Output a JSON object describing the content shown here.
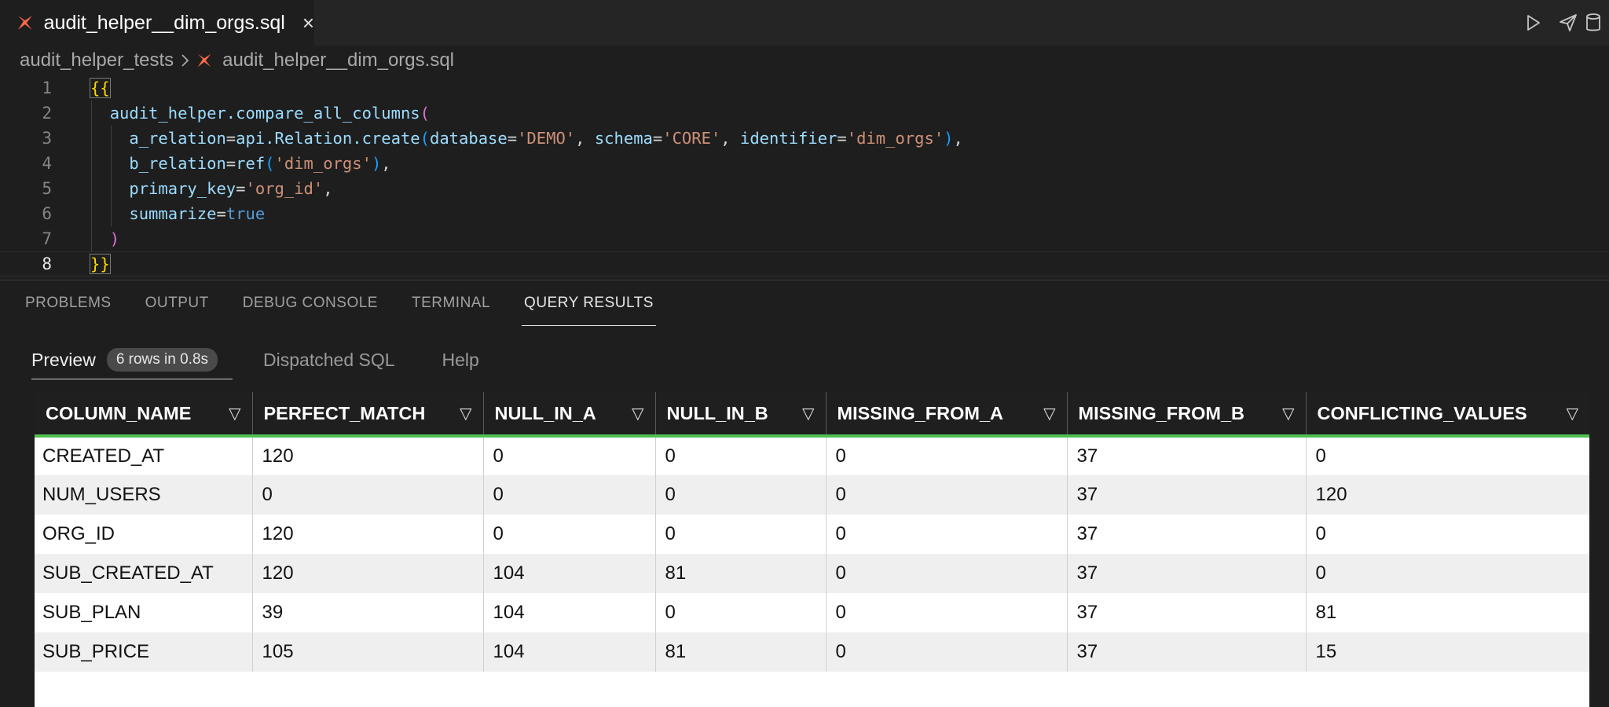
{
  "tab": {
    "title": "audit_helper__dim_orgs.sql",
    "close": "×"
  },
  "actions": [
    "run-icon",
    "send-icon",
    "database-icon"
  ],
  "breadcrumb": {
    "folder": "audit_helper_tests",
    "file": "audit_helper__dim_orgs.sql"
  },
  "editor": {
    "line_numbers": [
      "1",
      "2",
      "3",
      "4",
      "5",
      "6",
      "7",
      "8"
    ],
    "lines": [
      [
        {
          "t": "{{",
          "c": "t-brace-box"
        }
      ],
      [
        {
          "t": "  ",
          "c": "t-plain"
        },
        {
          "t": "audit_helper.compare_all_columns",
          "c": "t-default"
        },
        {
          "t": "(",
          "c": "t-paren1"
        }
      ],
      [
        {
          "t": "    ",
          "c": "t-plain"
        },
        {
          "t": "a_relation",
          "c": "t-param"
        },
        {
          "t": "=",
          "c": "t-plain"
        },
        {
          "t": "api.Relation.create",
          "c": "t-default"
        },
        {
          "t": "(",
          "c": "t-paren2"
        },
        {
          "t": "database",
          "c": "t-param"
        },
        {
          "t": "=",
          "c": "t-plain"
        },
        {
          "t": "'DEMO'",
          "c": "t-string"
        },
        {
          "t": ", ",
          "c": "t-plain"
        },
        {
          "t": "schema",
          "c": "t-param"
        },
        {
          "t": "=",
          "c": "t-plain"
        },
        {
          "t": "'CORE'",
          "c": "t-string"
        },
        {
          "t": ", ",
          "c": "t-plain"
        },
        {
          "t": "identifier",
          "c": "t-param"
        },
        {
          "t": "=",
          "c": "t-plain"
        },
        {
          "t": "'dim_orgs'",
          "c": "t-string"
        },
        {
          "t": ")",
          "c": "t-paren2"
        },
        {
          "t": ",",
          "c": "t-plain"
        }
      ],
      [
        {
          "t": "    ",
          "c": "t-plain"
        },
        {
          "t": "b_relation",
          "c": "t-param"
        },
        {
          "t": "=",
          "c": "t-plain"
        },
        {
          "t": "ref",
          "c": "t-default"
        },
        {
          "t": "(",
          "c": "t-paren2"
        },
        {
          "t": "'dim_orgs'",
          "c": "t-string"
        },
        {
          "t": ")",
          "c": "t-paren2"
        },
        {
          "t": ",",
          "c": "t-plain"
        }
      ],
      [
        {
          "t": "    ",
          "c": "t-plain"
        },
        {
          "t": "primary_key",
          "c": "t-param"
        },
        {
          "t": "=",
          "c": "t-plain"
        },
        {
          "t": "'org_id'",
          "c": "t-string"
        },
        {
          "t": ",",
          "c": "t-plain"
        }
      ],
      [
        {
          "t": "    ",
          "c": "t-plain"
        },
        {
          "t": "summarize",
          "c": "t-param"
        },
        {
          "t": "=",
          "c": "t-plain"
        },
        {
          "t": "true",
          "c": "t-bool"
        }
      ],
      [
        {
          "t": "  ",
          "c": "t-plain"
        },
        {
          "t": ")",
          "c": "t-paren1"
        }
      ],
      [
        {
          "t": "}}",
          "c": "t-brace-box"
        }
      ]
    ]
  },
  "panel": {
    "tabs": [
      "PROBLEMS",
      "OUTPUT",
      "DEBUG CONSOLE",
      "TERMINAL",
      "QUERY RESULTS"
    ],
    "active_tab": "QUERY RESULTS"
  },
  "results": {
    "sub_tabs": {
      "preview": "Preview",
      "badge": "6 rows in 0.8s",
      "dispatched": "Dispatched SQL",
      "help": "Help"
    },
    "filter_glyph": "▽",
    "columns": [
      "COLUMN_NAME",
      "PERFECT_MATCH",
      "NULL_IN_A",
      "NULL_IN_B",
      "MISSING_FROM_A",
      "MISSING_FROM_B",
      "CONFLICTING_VALUES"
    ],
    "rows": [
      [
        "CREATED_AT",
        "120",
        "0",
        "0",
        "0",
        "37",
        "0"
      ],
      [
        "NUM_USERS",
        "0",
        "0",
        "0",
        "0",
        "37",
        "120"
      ],
      [
        "ORG_ID",
        "120",
        "0",
        "0",
        "0",
        "37",
        "0"
      ],
      [
        "SUB_CREATED_AT",
        "120",
        "104",
        "81",
        "0",
        "37",
        "0"
      ],
      [
        "SUB_PLAN",
        "39",
        "104",
        "0",
        "0",
        "37",
        "81"
      ],
      [
        "SUB_PRICE",
        "105",
        "104",
        "81",
        "0",
        "37",
        "15"
      ]
    ]
  },
  "colors": {
    "accent_green": "#4ec04f",
    "dbt_orange": "#ff694a"
  }
}
